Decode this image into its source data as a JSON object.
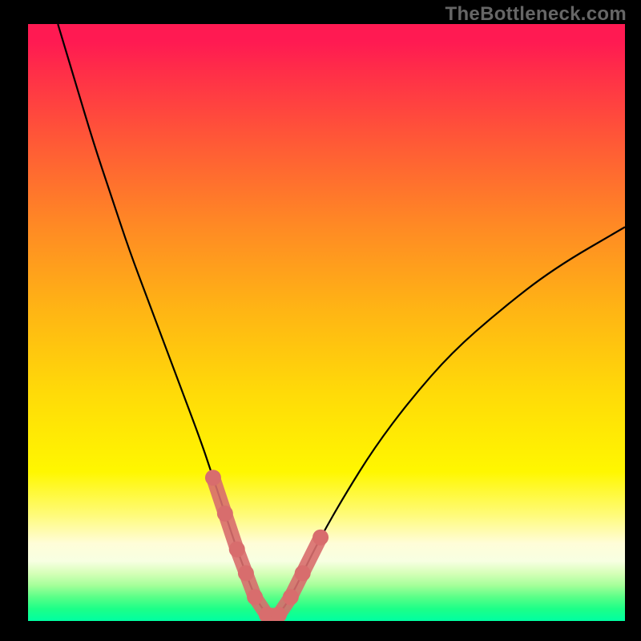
{
  "watermark": "TheBottleneck.com",
  "colors": {
    "background": "#000000",
    "curve_stroke": "#000000",
    "marker_fill": "#d86d6d",
    "gradient_top": "#ff1a52",
    "gradient_bottom": "#00ffa2"
  },
  "chart_data": {
    "type": "line",
    "title": "",
    "xlabel": "",
    "ylabel": "",
    "xlim": [
      0,
      100
    ],
    "ylim": [
      0,
      100
    ],
    "grid": false,
    "legend": false,
    "series": [
      {
        "name": "bottleneck-curve",
        "x": [
          5,
          8,
          11,
          14,
          17,
          20,
          23,
          26,
          29,
          31,
          33,
          35,
          36.5,
          38,
          40,
          42,
          44,
          46,
          49,
          53,
          58,
          64,
          71,
          79,
          88,
          100
        ],
        "values": [
          100,
          90,
          80,
          71,
          62,
          54,
          46,
          38,
          30,
          24,
          18,
          12,
          8,
          4,
          1,
          1,
          4,
          8,
          14,
          21,
          29,
          37,
          45,
          52,
          59,
          66
        ]
      }
    ],
    "markers": {
      "name": "highlight-points",
      "x": [
        31,
        33,
        35,
        36.5,
        38,
        40,
        42,
        44,
        46,
        49
      ],
      "values": [
        24,
        18,
        12,
        8,
        4,
        1,
        1,
        4,
        8,
        14
      ]
    }
  }
}
